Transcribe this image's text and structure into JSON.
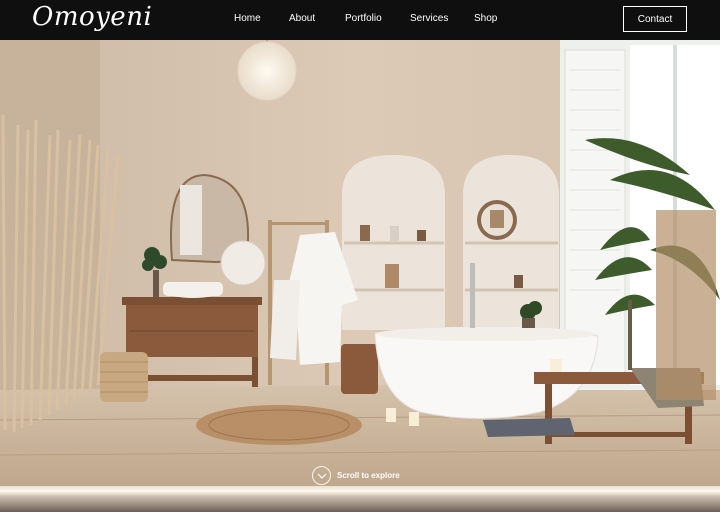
{
  "brand": {
    "logo_text": "Omoyeni"
  },
  "nav": {
    "items": [
      {
        "label": "Home"
      },
      {
        "label": "About"
      },
      {
        "label": "Portfolio"
      },
      {
        "label": "Services"
      },
      {
        "label": "Shop"
      }
    ],
    "contact_label": "Contact"
  },
  "hero": {
    "scroll_label": "Scroll to explore",
    "scroll_icon": "chevron-down-icon",
    "image_subject": "bathroom-interior-photo"
  },
  "colors": {
    "nav_bg": "#0f0f0f",
    "wall": "#d9c7b4",
    "floor": "#c9b39a",
    "text": "#ffffff"
  }
}
